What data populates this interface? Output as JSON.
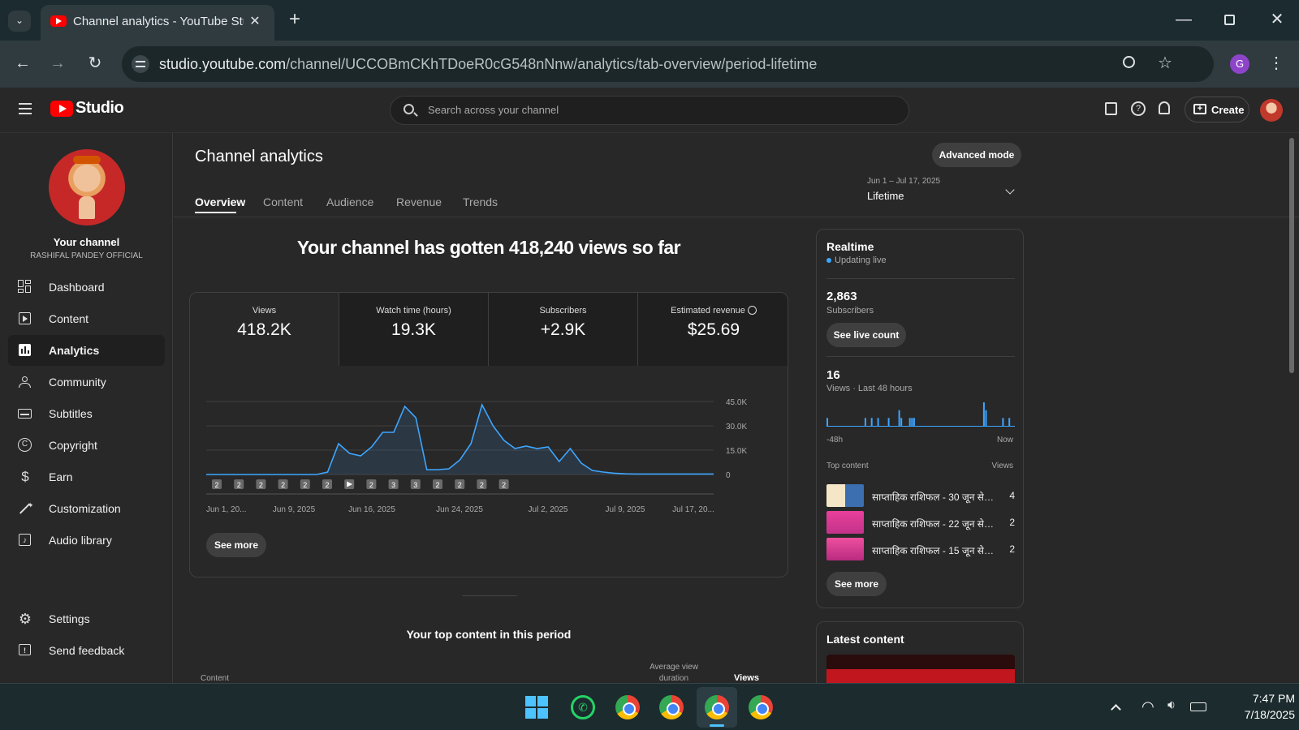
{
  "browser": {
    "tab_title": "Channel analytics - YouTube Studio",
    "url_domain": "studio.youtube.com",
    "url_path": "/channel/UCCOBmCKhTDoeR0cG548nNnw/analytics/tab-overview/period-lifetime",
    "profile_letter": "G"
  },
  "studio": {
    "logo_text": "Studio",
    "search_placeholder": "Search across your channel",
    "create_label": "Create"
  },
  "sidebar": {
    "channel_heading": "Your channel",
    "channel_name": "RASHIFAL PANDEY OFFICIAL",
    "items": [
      {
        "label": "Dashboard",
        "icon": "dashboard-icon"
      },
      {
        "label": "Content",
        "icon": "content-icon"
      },
      {
        "label": "Analytics",
        "icon": "analytics-icon",
        "active": true
      },
      {
        "label": "Community",
        "icon": "community-icon"
      },
      {
        "label": "Subtitles",
        "icon": "subtitles-icon"
      },
      {
        "label": "Copyright",
        "icon": "copyright-icon"
      },
      {
        "label": "Earn",
        "icon": "earn-icon"
      },
      {
        "label": "Customization",
        "icon": "customization-icon"
      },
      {
        "label": "Audio library",
        "icon": "audio-library-icon"
      }
    ],
    "settings_label": "Settings",
    "feedback_label": "Send feedback"
  },
  "main": {
    "page_title": "Channel analytics",
    "advanced_mode_label": "Advanced mode",
    "tabs": [
      "Overview",
      "Content",
      "Audience",
      "Revenue",
      "Trends"
    ],
    "period_range": "Jun 1 – Jul 17, 2025",
    "period_label": "Lifetime",
    "headline": "Your channel has gotten 418,240 views so far",
    "metrics": [
      {
        "label": "Views",
        "value": "418.2K"
      },
      {
        "label": "Watch time (hours)",
        "value": "19.3K"
      },
      {
        "label": "Subscribers",
        "value": "+2.9K"
      },
      {
        "label": "Estimated revenue",
        "value": "$25.69"
      }
    ],
    "see_more_label": "See more",
    "top_content_title": "Your top content in this period",
    "table_headers": {
      "content": "Content",
      "avg_duration": "Average view duration",
      "views": "Views"
    }
  },
  "chart_data": {
    "type": "area",
    "series": [
      {
        "values": [
          0,
          0,
          0,
          0,
          0,
          0,
          0,
          0,
          0,
          0,
          0,
          1500,
          19000,
          13000,
          11500,
          17000,
          26000,
          26000,
          42000,
          35000,
          3000,
          3000,
          3500,
          9000,
          19000,
          43000,
          30000,
          21000,
          16000,
          17500,
          16000,
          17000,
          8000,
          16000,
          7000,
          2500,
          1500,
          800,
          400,
          300,
          300,
          300,
          300,
          300,
          300,
          300,
          300
        ]
      }
    ],
    "x_ticks": [
      "Jun 1, 20...",
      "Jun 9, 2025",
      "Jun 16, 2025",
      "Jun 24, 2025",
      "Jul 2, 2025",
      "Jul 9, 2025",
      "Jul 17, 20..."
    ],
    "y_ticks": [
      "45.0K",
      "30.0K",
      "15.0K",
      "0"
    ],
    "ylim": [
      0,
      45000
    ],
    "markers": [
      "2",
      "2",
      "2",
      "2",
      "2",
      "2",
      "play",
      "2",
      "3",
      "3",
      "2",
      "2",
      "2",
      "2"
    ],
    "color": "#3ea6ff"
  },
  "realtime": {
    "title": "Realtime",
    "status": "Updating live",
    "subscribers_value": "2,863",
    "subscribers_label": "Subscribers",
    "live_count_label": "See live count",
    "views_value": "16",
    "views_label": "Views · Last 48 hours",
    "bars": [
      1,
      0,
      0,
      0,
      0,
      0,
      0,
      0,
      0,
      0,
      0,
      0,
      0,
      0,
      0,
      0,
      0,
      0,
      1,
      0,
      0,
      1,
      0,
      0,
      1,
      0,
      0,
      0,
      0,
      1,
      0,
      0,
      0,
      0,
      2,
      1,
      0,
      0,
      0,
      1,
      1,
      1,
      0,
      0,
      0,
      0,
      0,
      0,
      0,
      0,
      0,
      0,
      0,
      0,
      0,
      0,
      0,
      0,
      0,
      0,
      0,
      0,
      0,
      0,
      0,
      0,
      0,
      0,
      0,
      0,
      0,
      0,
      0,
      0,
      3,
      2,
      0,
      0,
      0,
      0,
      0,
      0,
      0,
      1,
      0,
      0,
      1,
      0,
      0
    ],
    "axis_start": "-48h",
    "axis_end": "Now",
    "top_content_label": "Top content",
    "top_views_label": "Views",
    "top_content": [
      {
        "title": "साप्ताहिक राशिफल - 30 जून से 0...",
        "views": "4"
      },
      {
        "title": "साप्ताहिक राशिफल - 22 जून से 2...",
        "views": "2"
      },
      {
        "title": "साप्ताहिक राशिफल - 15 जून से 2...",
        "views": "2"
      }
    ],
    "see_more_label": "See more"
  },
  "latest": {
    "title": "Latest content"
  },
  "taskbar": {
    "time": "7:47 PM",
    "date": "7/18/2025"
  }
}
